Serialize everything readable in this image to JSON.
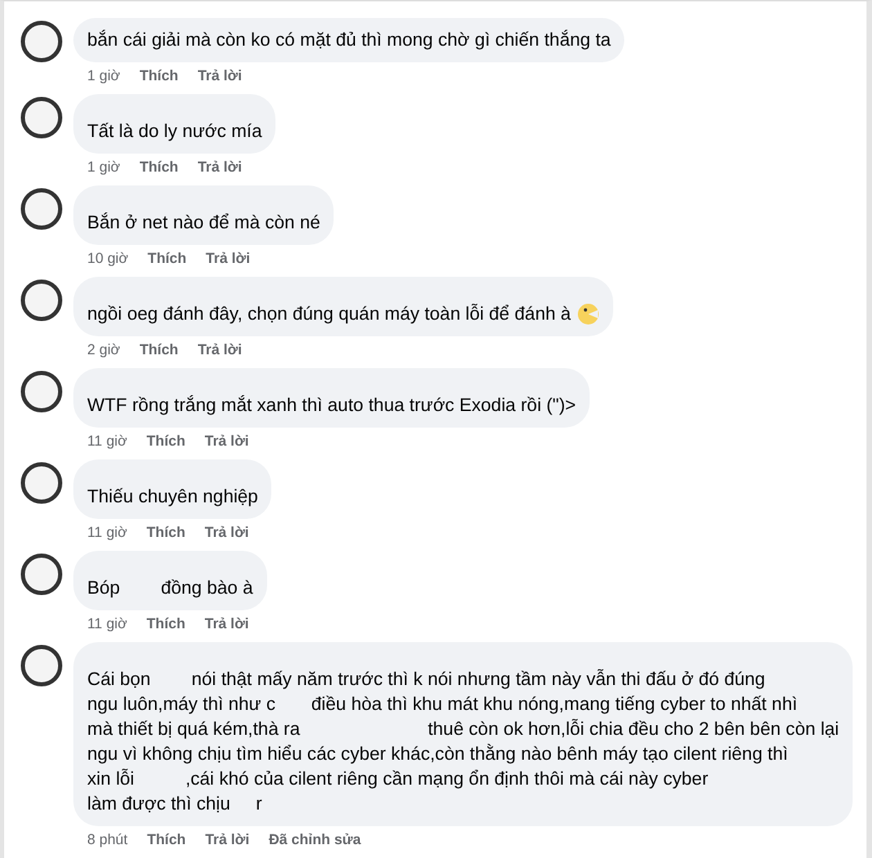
{
  "comments": [
    {
      "text": "bắn cái giải mà còn ko có mặt đủ thì mong chờ gì chiến thắng ta",
      "name_line": false,
      "emoji": false,
      "time": "1 giờ",
      "like": "Thích",
      "reply": "Trả lời"
    },
    {
      "text": "Tất là do ly nước mía",
      "name_line": true,
      "emoji": false,
      "time": "1 giờ",
      "like": "Thích",
      "reply": "Trả lời"
    },
    {
      "text": "Bắn ở net nào để mà còn né",
      "name_line": true,
      "emoji": false,
      "time": "10 giờ",
      "like": "Thích",
      "reply": "Trả lời"
    },
    {
      "text": "ngồi oeg đánh đây, chọn đúng quán máy toàn lỗi để đánh à",
      "name_line": true,
      "emoji": true,
      "time": "2 giờ",
      "like": "Thích",
      "reply": "Trả lời"
    },
    {
      "text": "WTF rồng trắng mắt xanh thì auto thua trước Exodia rồi (\")>",
      "name_line": true,
      "emoji": false,
      "time": "11 giờ",
      "like": "Thích",
      "reply": "Trả lời"
    },
    {
      "text": "Thiếu chuyên nghiệp",
      "name_line": true,
      "emoji": false,
      "time": "11 giờ",
      "like": "Thích",
      "reply": "Trả lời"
    },
    {
      "text": "Bóp        đồng bào à",
      "name_line": true,
      "emoji": false,
      "time": "11 giờ",
      "like": "Thích",
      "reply": "Trả lời"
    },
    {
      "text": "Cái bọn        nói thật mấy năm trước thì k nói nhưng tầm này vẫn thi đấu ở đó đúng\nngu luôn,máy thì như c       điều hòa thì khu mát khu nóng,mang tiếng cyber to nhất nhì\nmà thiết bị quá kém,thà ra                         thuê còn ok hơn,lỗi chia đều cho 2 bên bên còn lại\nngu vì không chịu tìm hiểu các cyber khác,còn thằng nào bênh máy tạo cilent riêng thì\nxin lỗi          ,cái khó của cilent riêng cần mạng ổn định thôi mà cái này cyber\nlàm được thì chịu     r",
      "name_line": true,
      "emoji": false,
      "time": "8 phút",
      "like": "Thích",
      "reply": "Trả lời",
      "edited": "Đã chỉnh sửa"
    }
  ]
}
